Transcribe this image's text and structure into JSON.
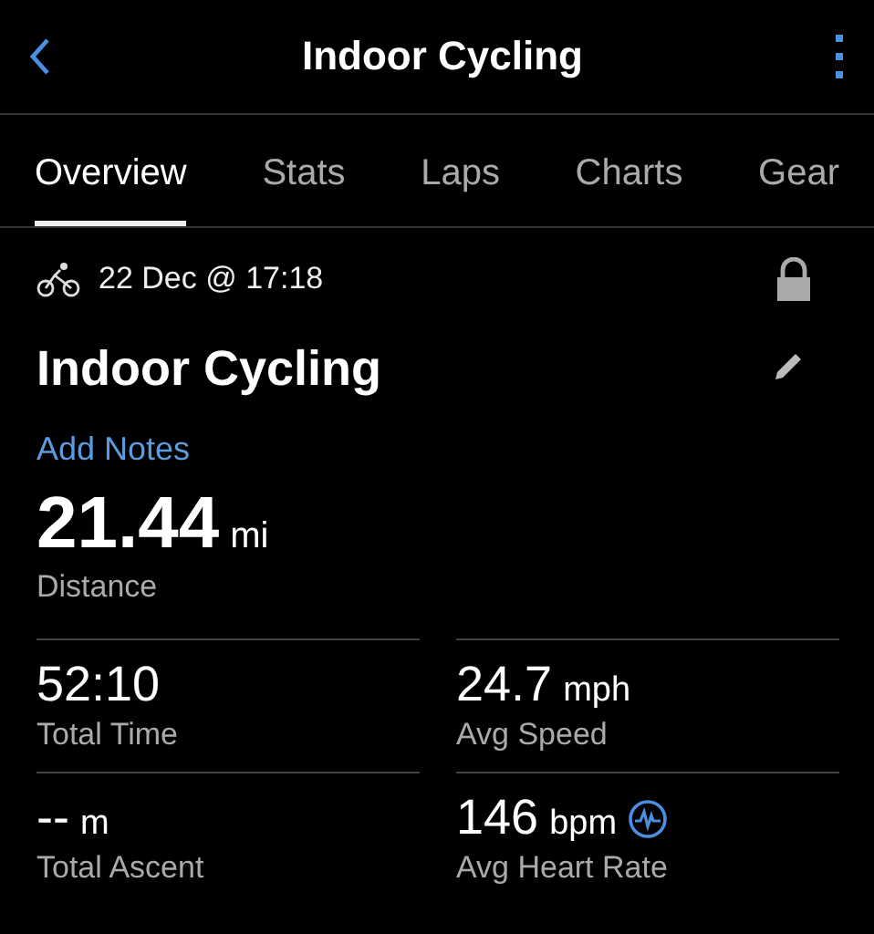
{
  "header": {
    "title": "Indoor Cycling"
  },
  "tabs": [
    {
      "label": "Overview",
      "selected": true
    },
    {
      "label": "Stats",
      "selected": false
    },
    {
      "label": "Laps",
      "selected": false
    },
    {
      "label": "Charts",
      "selected": false
    },
    {
      "label": "Gear",
      "selected": false
    }
  ],
  "activity": {
    "date": "22 Dec @ 17:18",
    "locked": true,
    "name": "Indoor Cycling",
    "notes_link": "Add Notes"
  },
  "distance": {
    "value": "21.44",
    "unit": "mi",
    "label": "Distance"
  },
  "stats": [
    {
      "kind": "plain",
      "value": "52:10",
      "label": "Total Time"
    },
    {
      "kind": "plain",
      "value": "24.7",
      "unit": "mph",
      "label": "Avg Speed"
    },
    {
      "kind": "plain",
      "value": "--",
      "unit": "m",
      "label": "Total Ascent"
    },
    {
      "kind": "heart",
      "value": "146",
      "unit": "bpm",
      "label": "Avg Heart Rate"
    }
  ]
}
